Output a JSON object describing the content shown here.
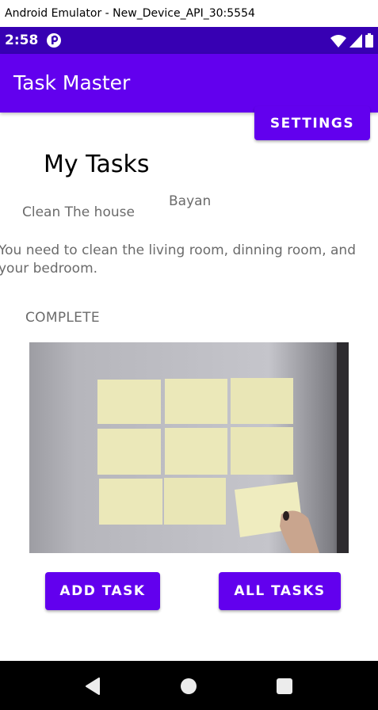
{
  "window": {
    "title": "Android Emulator - New_Device_API_30:5554"
  },
  "status_bar": {
    "time": "2:58",
    "icons": [
      "app-notification-icon",
      "wifi-icon",
      "signal-icon",
      "battery-icon"
    ]
  },
  "app_bar": {
    "title": "Task Master"
  },
  "buttons": {
    "settings": "SETTINGS",
    "add_task": "ADD TASK",
    "all_tasks": "ALL TASKS"
  },
  "main": {
    "heading": "My Tasks",
    "task": {
      "title": "Clean The house",
      "user": "Bayan",
      "body": "You need to clean the living room, dinning room, and your bedroom.",
      "state": "COMPLETE",
      "image_icon": "sticky-notes-photo"
    }
  },
  "navigation": {
    "icons": [
      "back-icon",
      "home-icon",
      "recent-apps-icon"
    ]
  },
  "colors": {
    "status_bar": "#3700b3",
    "primary": "#6200ee",
    "secondary_text": "#6b6b6b",
    "nav_bar": "#000000"
  }
}
